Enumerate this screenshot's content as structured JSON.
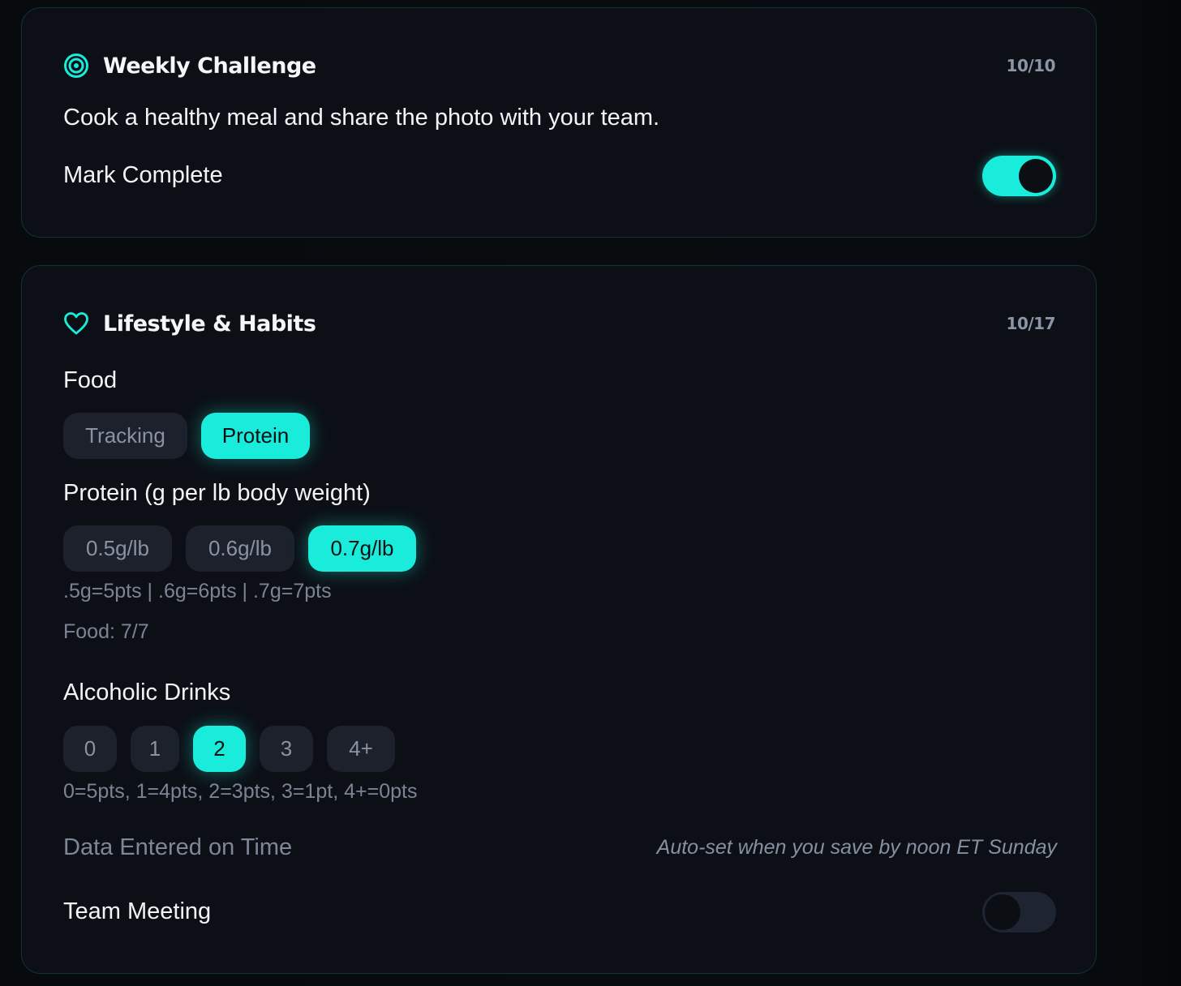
{
  "colors": {
    "accent": "#19ecda",
    "card_bg": "#0c1016",
    "card_border": "#12323a",
    "pill_bg": "#1c212c",
    "muted_text": "#7b8494"
  },
  "weekly_challenge": {
    "icon": "target-icon",
    "title": "Weekly Challenge",
    "score": "10/10",
    "description": "Cook a healthy meal and share the photo with your team.",
    "mark_complete_label": "Mark Complete",
    "mark_complete_on": true
  },
  "lifestyle": {
    "icon": "heart-icon",
    "title": "Lifestyle & Habits",
    "score": "10/17",
    "food": {
      "label": "Food",
      "tabs": [
        "Tracking",
        "Protein"
      ],
      "active_tab": "Protein",
      "protein_label": "Protein (g per lb body weight)",
      "protein_options": [
        "0.5g/lb",
        "0.6g/lb",
        "0.7g/lb"
      ],
      "protein_selected": "0.7g/lb",
      "protein_hint": ".5g=5pts | .6g=6pts | .7g=7pts",
      "food_total": "Food: 7/7"
    },
    "alcohol": {
      "label": "Alcoholic Drinks",
      "options": [
        "0",
        "1",
        "2",
        "3",
        "4+"
      ],
      "selected": "2",
      "hint": "0=5pts, 1=4pts, 2=3pts, 3=1pt, 4+=0pts"
    },
    "data_on_time": {
      "label": "Data Entered on Time",
      "note": "Auto-set when you save by noon ET Sunday"
    },
    "team_meeting": {
      "label": "Team Meeting",
      "on": false
    }
  }
}
